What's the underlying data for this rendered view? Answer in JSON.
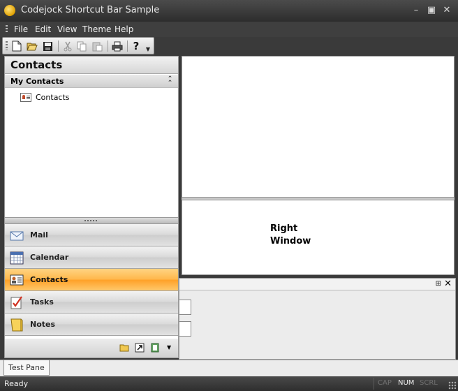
{
  "window": {
    "title": "Codejock Shortcut Bar Sample"
  },
  "menu": {
    "items": [
      "File",
      "Edit",
      "View",
      "Theme",
      "Help"
    ]
  },
  "toolbar": {
    "buttons": [
      "new-file-icon",
      "open-folder-icon",
      "save-icon",
      "cut-icon",
      "copy-icon",
      "paste-icon",
      "print-icon",
      "help-icon",
      "toolbar-options-icon"
    ]
  },
  "left_panel": {
    "title": "Contacts",
    "group": {
      "label": "My Contacts",
      "items": [
        {
          "label": "Contacts",
          "icon": "contact-card-icon"
        }
      ]
    },
    "nav_buttons": [
      {
        "label": "Mail",
        "icon": "envelope-icon",
        "active": false
      },
      {
        "label": "Calendar",
        "icon": "calendar-icon",
        "active": false
      },
      {
        "label": "Contacts",
        "icon": "contact-card-icon",
        "active": true
      },
      {
        "label": "Tasks",
        "icon": "task-check-icon",
        "active": false
      },
      {
        "label": "Notes",
        "icon": "notes-icon",
        "active": false
      }
    ],
    "bottom_strip_icons": [
      "folder-icon",
      "shortcut-icon",
      "contact-folder-icon",
      "overflow-dropdown-icon"
    ]
  },
  "right_window": {
    "text": "Right Window"
  },
  "dock_pane": {
    "tab_label": "Test Pane"
  },
  "status": {
    "text": "Ready",
    "indicators": [
      {
        "label": "CAP",
        "active": false
      },
      {
        "label": "NUM",
        "active": true
      },
      {
        "label": "SCRL",
        "active": false
      }
    ]
  },
  "colors": {
    "active_nav": "#ffb64a",
    "chrome": "#3a3a3a"
  }
}
